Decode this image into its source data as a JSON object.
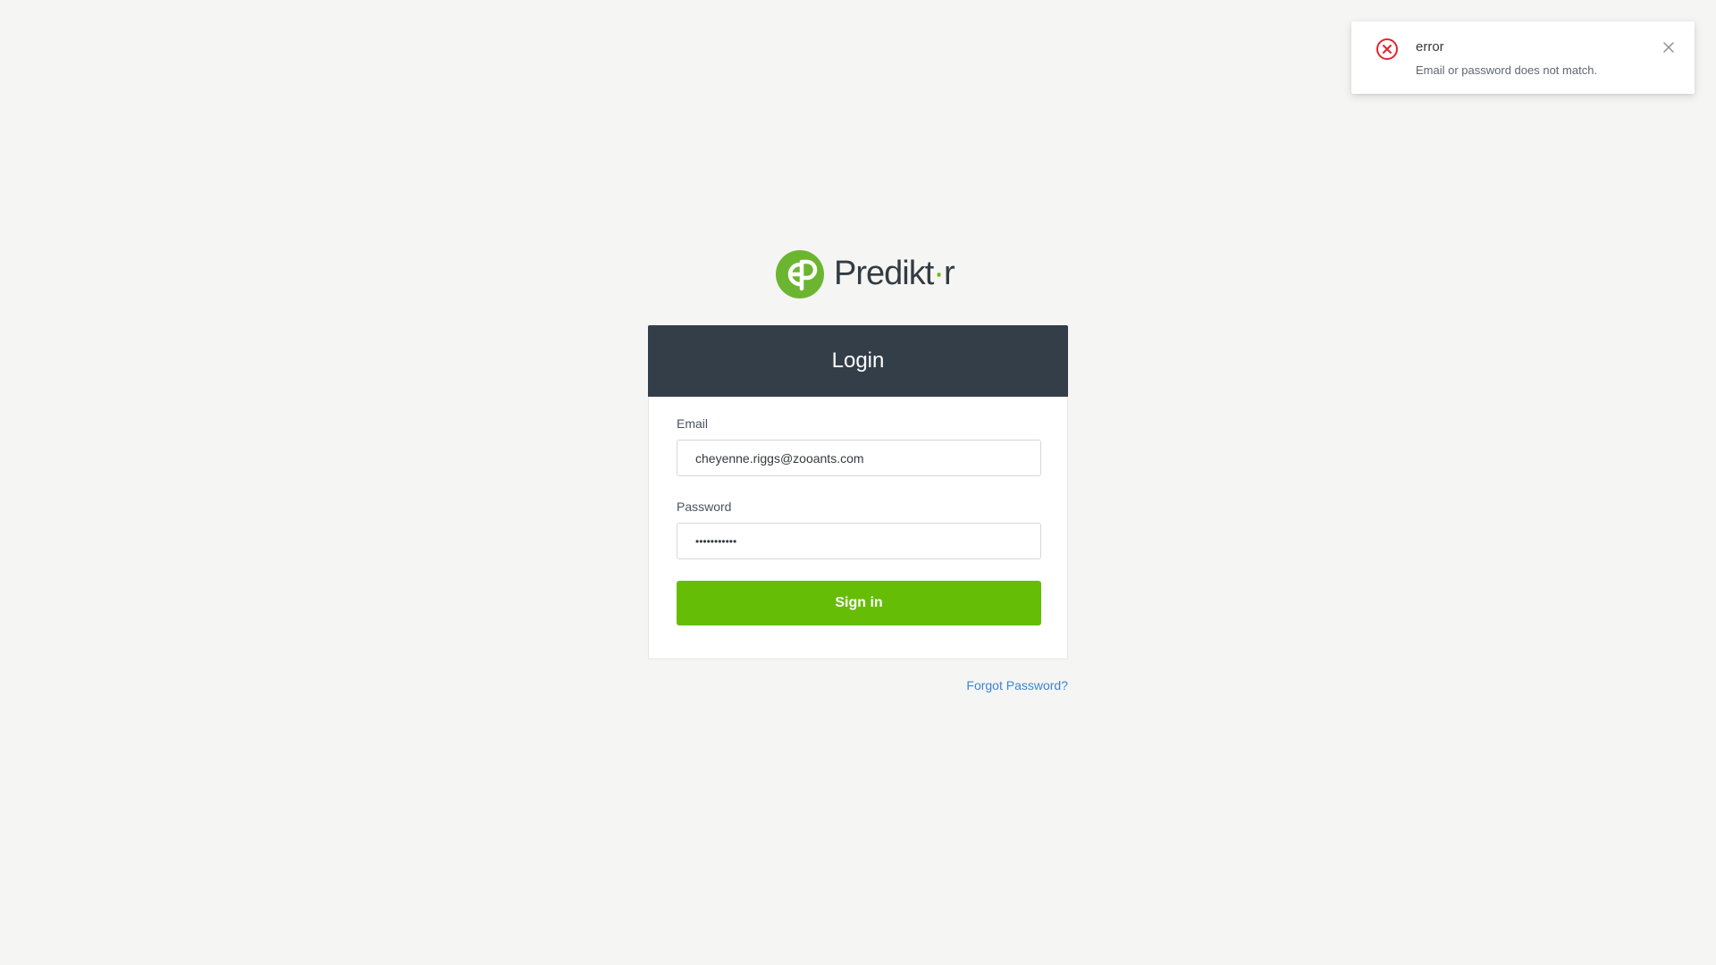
{
  "notification": {
    "title": "error",
    "message": "Email or password does not match.",
    "icon": "error-circle-icon",
    "close_icon": "close-icon",
    "accent_color": "#e0262b"
  },
  "brand": {
    "name_prefix": "Predikt",
    "name_dot": "·",
    "name_suffix": "r",
    "logo_icon": "prediktr-logo-badge",
    "brand_color": "#66bd06"
  },
  "login": {
    "title": "Login",
    "email_label": "Email",
    "email_value": "cheyenne.riggs@zooants.com",
    "password_label": "Password",
    "password_value": "•••••••••••",
    "submit_label": "Sign in"
  },
  "links": {
    "forgot_password": "Forgot Password?"
  },
  "colors": {
    "header_bg": "#333e48",
    "link": "#3a85d6",
    "page_bg": "#f5f5f3"
  }
}
